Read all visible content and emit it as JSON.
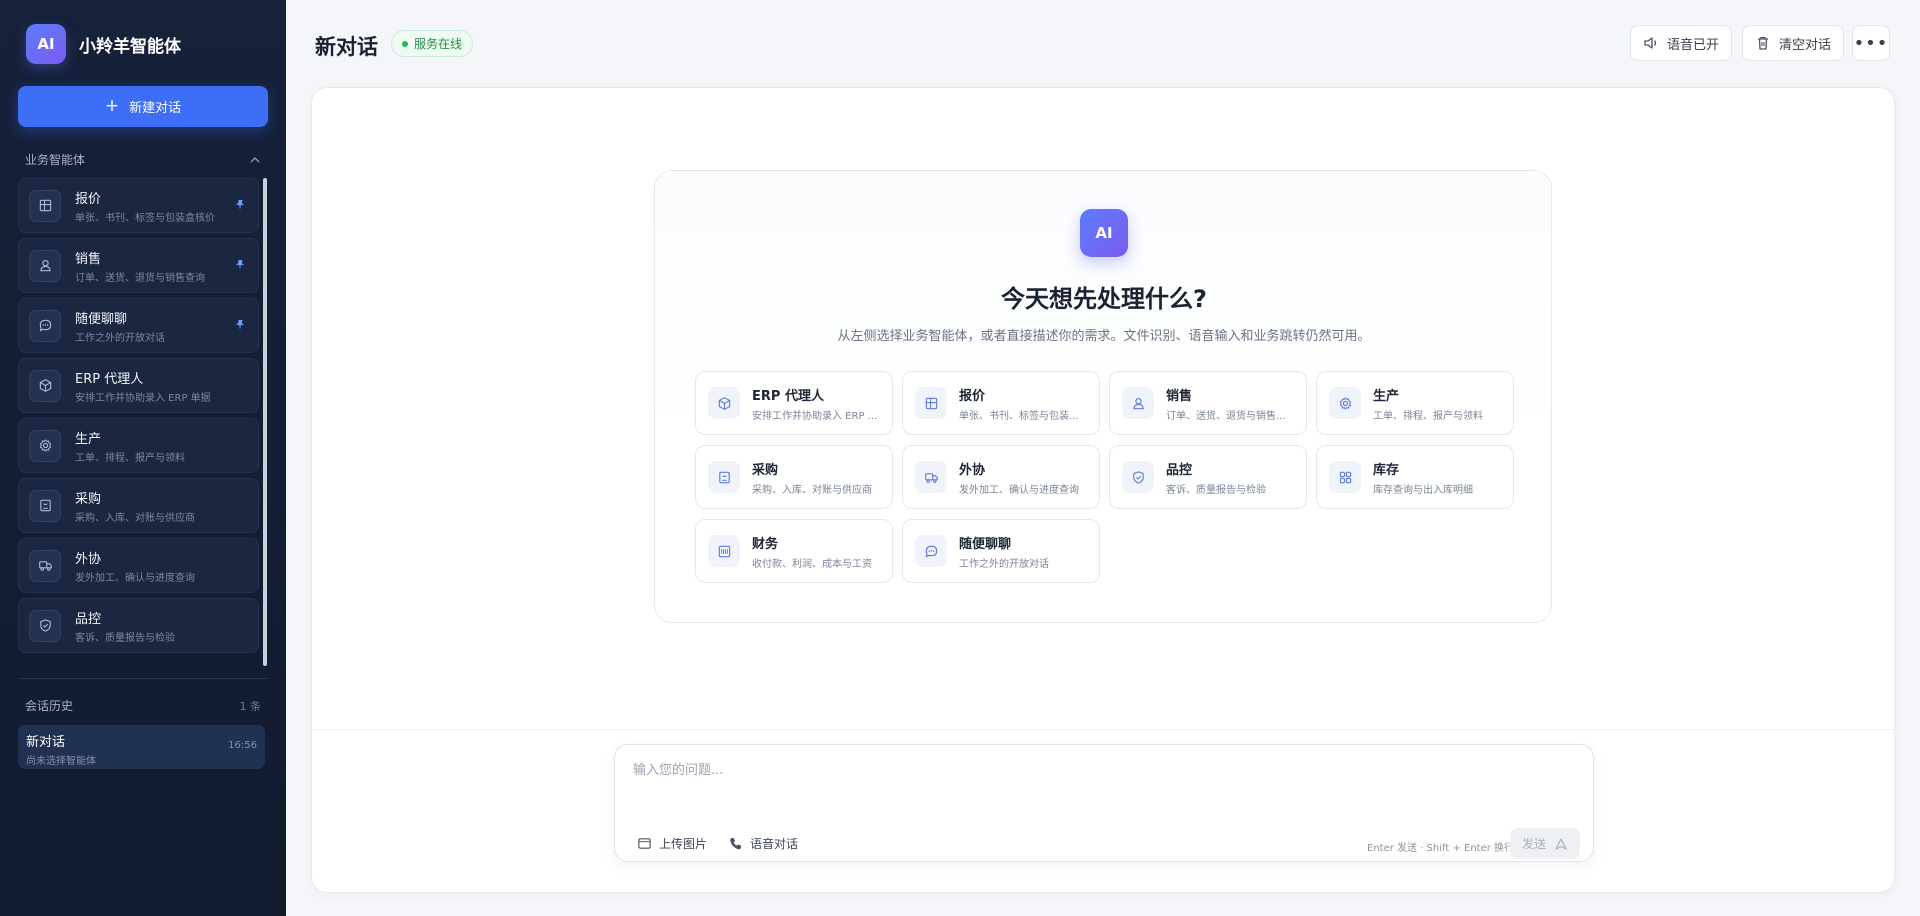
{
  "sidebar": {
    "brand_logo": "AI",
    "brand_name": "小羚羊智能体",
    "new_chat_label": "新建对话",
    "agents_section": "业务智能体",
    "agents": [
      {
        "name": "报价",
        "desc": "单张、书刊、标签与包装盒核价",
        "icon": "layout-icon",
        "pinned": true
      },
      {
        "name": "销售",
        "desc": "订单、送货、退货与销售查询",
        "icon": "user-icon",
        "pinned": true
      },
      {
        "name": "随便聊聊",
        "desc": "工作之外的开放对话",
        "icon": "chat-icon",
        "pinned": true
      },
      {
        "name": "ERP 代理人",
        "desc": "安排工作并协助录入 ERP 单据",
        "icon": "cube-icon",
        "pinned": false
      },
      {
        "name": "生产",
        "desc": "工单、排程、报产与领料",
        "icon": "gear-icon",
        "pinned": false
      },
      {
        "name": "采购",
        "desc": "采购、入库、对账与供应商",
        "icon": "box-icon",
        "pinned": false
      },
      {
        "name": "外协",
        "desc": "发外加工、确认与进度查询",
        "icon": "truck-icon",
        "pinned": false
      },
      {
        "name": "品控",
        "desc": "客诉、质量报告与检验",
        "icon": "shield-icon",
        "pinned": false
      }
    ],
    "history_section": "会话历史",
    "history_count": "1 条",
    "history": [
      {
        "title": "新对话",
        "sub": "尚未选择智能体",
        "time": "16:56"
      }
    ]
  },
  "topbar": {
    "title": "新对话",
    "status": "服务在线",
    "voice_label": "语音已开",
    "clear_label": "清空对话",
    "more_label": "•••"
  },
  "welcome": {
    "logo": "AI",
    "title": "今天想先处理什么?",
    "subtitle": "从左侧选择业务智能体，或者直接描述你的需求。文件识别、语音输入和业务跳转仍然可用。",
    "cards": [
      {
        "name": "ERP 代理人",
        "desc": "安排工作并协助录入 ERP ...",
        "icon": "cube-icon"
      },
      {
        "name": "报价",
        "desc": "单张、书刊、标签与包装...",
        "icon": "layout-icon"
      },
      {
        "name": "销售",
        "desc": "订单、送货、退货与销售...",
        "icon": "user-icon"
      },
      {
        "name": "生产",
        "desc": "工单、排程、报产与领料",
        "icon": "gear-icon"
      },
      {
        "name": "采购",
        "desc": "采购、入库、对账与供应商",
        "icon": "box-icon"
      },
      {
        "name": "外协",
        "desc": "发外加工、确认与进度查询",
        "icon": "truck-icon"
      },
      {
        "name": "品控",
        "desc": "客诉、质量报告与检验",
        "icon": "shield-icon"
      },
      {
        "name": "库存",
        "desc": "库存查询与出入库明细",
        "icon": "grid-icon"
      },
      {
        "name": "财务",
        "desc": "收付款、利润、成本与工资",
        "icon": "calculator-icon"
      },
      {
        "name": "随便聊聊",
        "desc": "工作之外的开放对话",
        "icon": "chat-icon"
      }
    ]
  },
  "composer": {
    "placeholder": "输入您的问题...",
    "upload_label": "上传图片",
    "voice_call_label": "语音对话",
    "hint": "Enter 发送 · Shift + Enter 换行",
    "send_label": "发送"
  },
  "colors": {
    "accent": "#3d6ef5",
    "sidebar_bg": "#16213a",
    "status_green": "#2fb35c"
  }
}
